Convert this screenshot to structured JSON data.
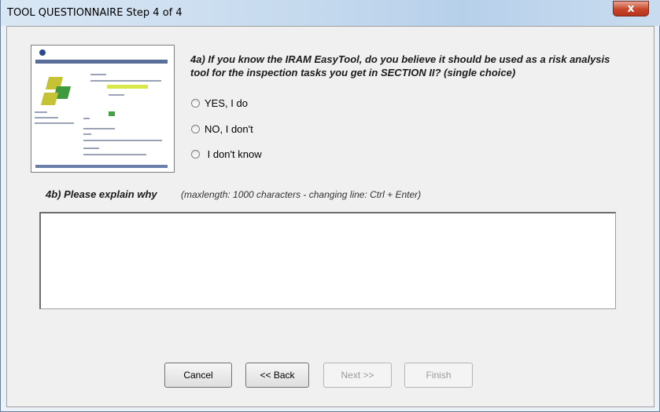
{
  "window": {
    "title": "TOOL QUESTIONNAIRE Step 4 of 4",
    "close_glyph": "x"
  },
  "question_4a": {
    "text": "4a) If you know the IRAM  EasyTool, do you believe it should be used as a risk analysis tool for the inspection tasks you get in SECTION II? (single choice)",
    "options": [
      "YES, I do",
      "NO, I don't",
      " I don't know"
    ],
    "selected": null
  },
  "question_4b": {
    "label": "4b) Please explain why",
    "hint": "(maxlength: 1000 characters - changing line: Ctrl + Enter)",
    "value": ""
  },
  "buttons": {
    "cancel": "Cancel",
    "back": "<< Back",
    "next": "Next >>",
    "finish": "Finish"
  },
  "colors": {
    "title_bar": "#c6daee",
    "close": "#c7462a",
    "dialog_bg": "#f0f0f0"
  }
}
